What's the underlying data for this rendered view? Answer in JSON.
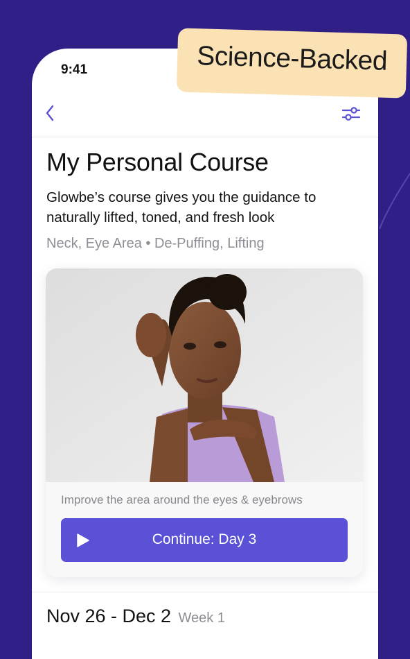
{
  "colors": {
    "background": "#2f1f86",
    "accent": "#5a51d6",
    "badge": "#fbe2b4",
    "muted_text": "#8d8d96"
  },
  "badge": {
    "label": "Science-Backed"
  },
  "status_bar": {
    "time": "9:41"
  },
  "nav": {
    "back_icon": "chevron-left-icon",
    "filter_icon": "sliders-icon"
  },
  "course": {
    "title": "My Personal Course",
    "description": "Glowbe’s course gives you the guidance to naturally lifted, toned, and fresh look",
    "tags": "Neck, Eye Area • De-Puffing, Lifting"
  },
  "lesson_card": {
    "caption": "Improve the area around the eyes & eyebrows",
    "button_label": "Continue: Day 3",
    "button_icon": "play-icon"
  },
  "schedule": {
    "date_range": "Nov 26 - Dec 2",
    "week": "Week 1"
  }
}
